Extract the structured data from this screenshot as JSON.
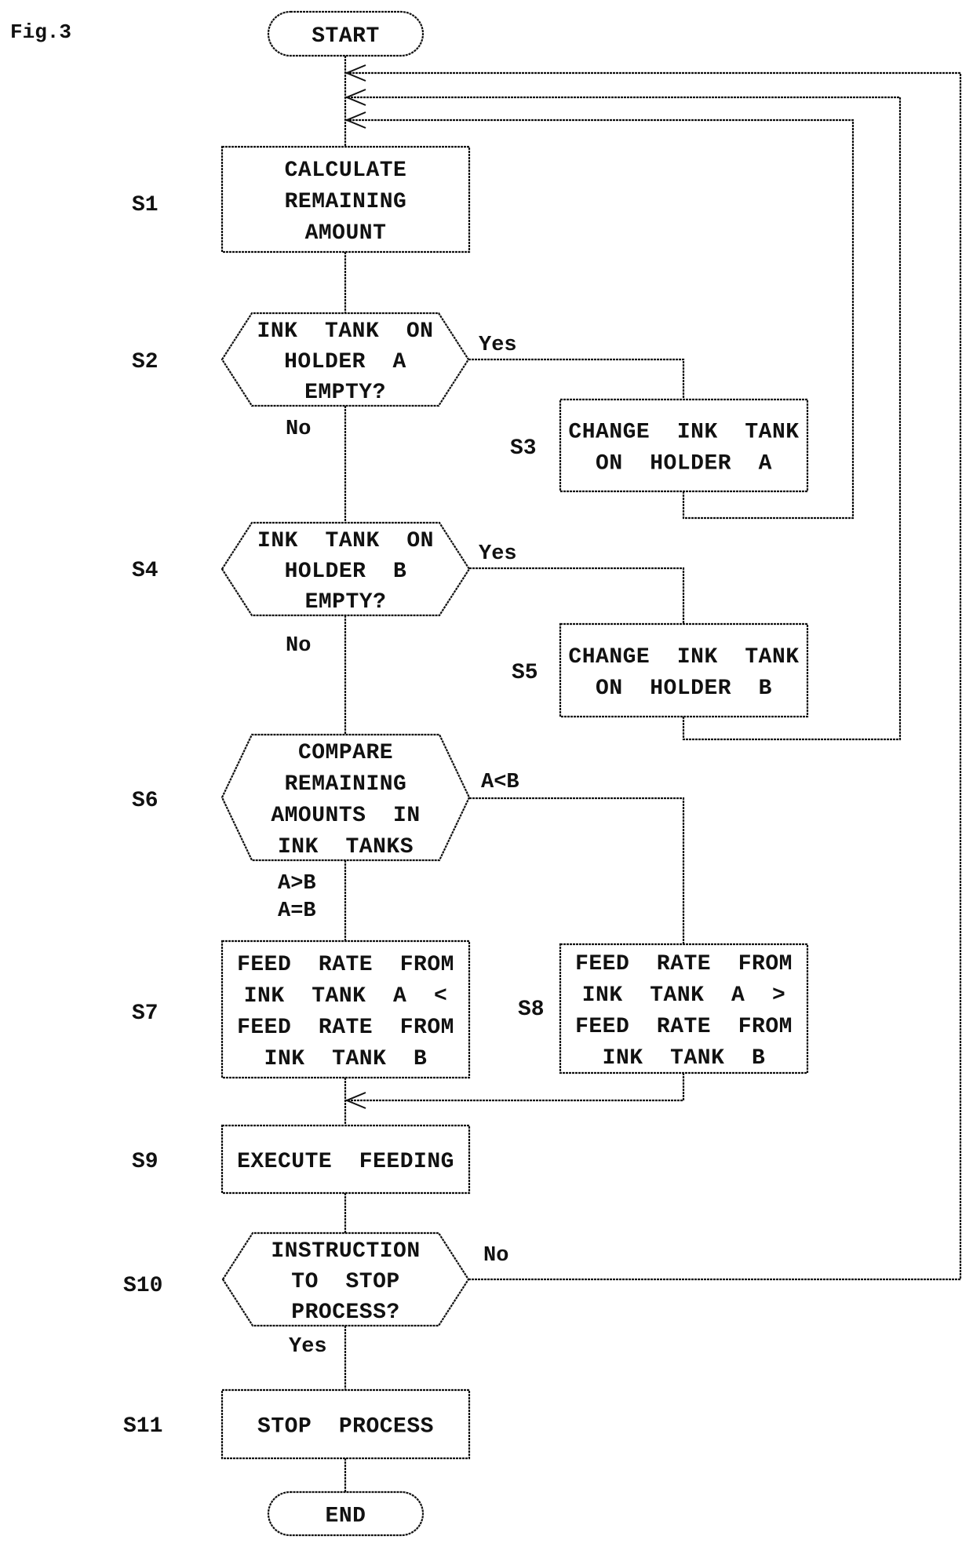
{
  "figure": {
    "title": "Fig.3",
    "colors": {
      "ink": "#111111",
      "background": "#ffffff"
    }
  },
  "nodes": {
    "start": {
      "lines": [
        "START"
      ]
    },
    "s1": {
      "step": "S1",
      "lines": [
        "CALCULATE",
        "REMAINING",
        "AMOUNT"
      ]
    },
    "s2": {
      "step": "S2",
      "lines": [
        "INK  TANK  ON",
        "HOLDER  A",
        "EMPTY?"
      ]
    },
    "s3": {
      "step": "S3",
      "lines": [
        "CHANGE  INK  TANK",
        "ON  HOLDER  A"
      ]
    },
    "s4": {
      "step": "S4",
      "lines": [
        "INK  TANK  ON",
        "HOLDER  B",
        "EMPTY?"
      ]
    },
    "s5": {
      "step": "S5",
      "lines": [
        "CHANGE  INK  TANK",
        "ON  HOLDER  B"
      ]
    },
    "s6": {
      "step": "S6",
      "lines": [
        "COMPARE",
        "REMAINING",
        "AMOUNTS  IN",
        "INK  TANKS"
      ]
    },
    "s7": {
      "step": "S7",
      "lines": [
        "FEED  RATE  FROM",
        "INK  TANK  A  <",
        "FEED  RATE  FROM",
        "INK  TANK  B"
      ]
    },
    "s8": {
      "step": "S8",
      "lines": [
        "FEED  RATE  FROM",
        "INK  TANK  A  >",
        "FEED  RATE  FROM",
        "INK  TANK  B"
      ]
    },
    "s9": {
      "step": "S9",
      "lines": [
        "EXECUTE  FEEDING"
      ]
    },
    "s10": {
      "step": "S10",
      "lines": [
        "INSTRUCTION",
        "TO  STOP",
        "PROCESS?"
      ]
    },
    "s11": {
      "step": "S11",
      "lines": [
        "STOP  PROCESS"
      ]
    },
    "end": {
      "lines": [
        "END"
      ]
    }
  },
  "branches": {
    "s2_yes": "Yes",
    "s2_no": "No",
    "s4_yes": "Yes",
    "s4_no": "No",
    "s6_lt": "A<B",
    "s6_gt": "A>B",
    "s6_eq": "A=B",
    "s10_no": "No",
    "s10_yes": "Yes"
  }
}
